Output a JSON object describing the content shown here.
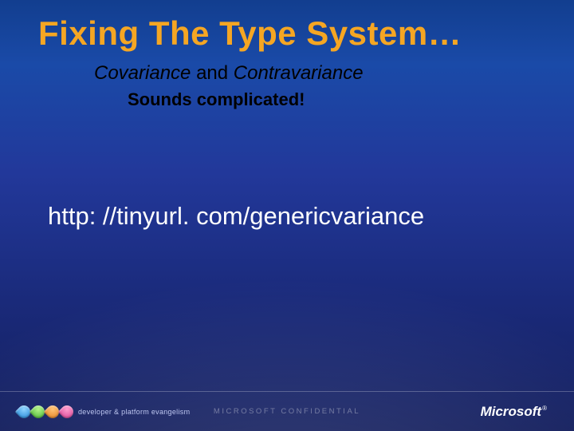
{
  "title": "Fixing The Type System…",
  "subtitle": {
    "term1": "Covariance",
    "joiner": " and ",
    "term2": "Contravariance"
  },
  "tagline": "Sounds complicated!",
  "url": "http: //tinyurl. com/genericvariance",
  "footer": {
    "dpe": "developer & platform evangelism",
    "confidential": "MICROSOFT CONFIDENTIAL",
    "brand": "Microsoft",
    "reg": "®"
  },
  "colors": {
    "accent": "#f5a623",
    "bg_top": "#1a4aa8",
    "bg_bottom": "#141f5e"
  }
}
